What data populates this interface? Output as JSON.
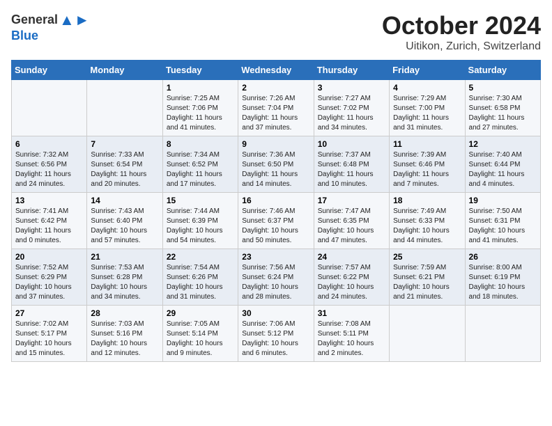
{
  "header": {
    "logo": {
      "line1": "General",
      "line2": "Blue"
    },
    "month": "October 2024",
    "location": "Uitikon, Zurich, Switzerland"
  },
  "weekdays": [
    "Sunday",
    "Monday",
    "Tuesday",
    "Wednesday",
    "Thursday",
    "Friday",
    "Saturday"
  ],
  "weeks": [
    [
      {
        "day": "",
        "info": ""
      },
      {
        "day": "",
        "info": ""
      },
      {
        "day": "1",
        "info": "Sunrise: 7:25 AM\nSunset: 7:06 PM\nDaylight: 11 hours and 41 minutes."
      },
      {
        "day": "2",
        "info": "Sunrise: 7:26 AM\nSunset: 7:04 PM\nDaylight: 11 hours and 37 minutes."
      },
      {
        "day": "3",
        "info": "Sunrise: 7:27 AM\nSunset: 7:02 PM\nDaylight: 11 hours and 34 minutes."
      },
      {
        "day": "4",
        "info": "Sunrise: 7:29 AM\nSunset: 7:00 PM\nDaylight: 11 hours and 31 minutes."
      },
      {
        "day": "5",
        "info": "Sunrise: 7:30 AM\nSunset: 6:58 PM\nDaylight: 11 hours and 27 minutes."
      }
    ],
    [
      {
        "day": "6",
        "info": "Sunrise: 7:32 AM\nSunset: 6:56 PM\nDaylight: 11 hours and 24 minutes."
      },
      {
        "day": "7",
        "info": "Sunrise: 7:33 AM\nSunset: 6:54 PM\nDaylight: 11 hours and 20 minutes."
      },
      {
        "day": "8",
        "info": "Sunrise: 7:34 AM\nSunset: 6:52 PM\nDaylight: 11 hours and 17 minutes."
      },
      {
        "day": "9",
        "info": "Sunrise: 7:36 AM\nSunset: 6:50 PM\nDaylight: 11 hours and 14 minutes."
      },
      {
        "day": "10",
        "info": "Sunrise: 7:37 AM\nSunset: 6:48 PM\nDaylight: 11 hours and 10 minutes."
      },
      {
        "day": "11",
        "info": "Sunrise: 7:39 AM\nSunset: 6:46 PM\nDaylight: 11 hours and 7 minutes."
      },
      {
        "day": "12",
        "info": "Sunrise: 7:40 AM\nSunset: 6:44 PM\nDaylight: 11 hours and 4 minutes."
      }
    ],
    [
      {
        "day": "13",
        "info": "Sunrise: 7:41 AM\nSunset: 6:42 PM\nDaylight: 11 hours and 0 minutes."
      },
      {
        "day": "14",
        "info": "Sunrise: 7:43 AM\nSunset: 6:40 PM\nDaylight: 10 hours and 57 minutes."
      },
      {
        "day": "15",
        "info": "Sunrise: 7:44 AM\nSunset: 6:39 PM\nDaylight: 10 hours and 54 minutes."
      },
      {
        "day": "16",
        "info": "Sunrise: 7:46 AM\nSunset: 6:37 PM\nDaylight: 10 hours and 50 minutes."
      },
      {
        "day": "17",
        "info": "Sunrise: 7:47 AM\nSunset: 6:35 PM\nDaylight: 10 hours and 47 minutes."
      },
      {
        "day": "18",
        "info": "Sunrise: 7:49 AM\nSunset: 6:33 PM\nDaylight: 10 hours and 44 minutes."
      },
      {
        "day": "19",
        "info": "Sunrise: 7:50 AM\nSunset: 6:31 PM\nDaylight: 10 hours and 41 minutes."
      }
    ],
    [
      {
        "day": "20",
        "info": "Sunrise: 7:52 AM\nSunset: 6:29 PM\nDaylight: 10 hours and 37 minutes."
      },
      {
        "day": "21",
        "info": "Sunrise: 7:53 AM\nSunset: 6:28 PM\nDaylight: 10 hours and 34 minutes."
      },
      {
        "day": "22",
        "info": "Sunrise: 7:54 AM\nSunset: 6:26 PM\nDaylight: 10 hours and 31 minutes."
      },
      {
        "day": "23",
        "info": "Sunrise: 7:56 AM\nSunset: 6:24 PM\nDaylight: 10 hours and 28 minutes."
      },
      {
        "day": "24",
        "info": "Sunrise: 7:57 AM\nSunset: 6:22 PM\nDaylight: 10 hours and 24 minutes."
      },
      {
        "day": "25",
        "info": "Sunrise: 7:59 AM\nSunset: 6:21 PM\nDaylight: 10 hours and 21 minutes."
      },
      {
        "day": "26",
        "info": "Sunrise: 8:00 AM\nSunset: 6:19 PM\nDaylight: 10 hours and 18 minutes."
      }
    ],
    [
      {
        "day": "27",
        "info": "Sunrise: 7:02 AM\nSunset: 5:17 PM\nDaylight: 10 hours and 15 minutes."
      },
      {
        "day": "28",
        "info": "Sunrise: 7:03 AM\nSunset: 5:16 PM\nDaylight: 10 hours and 12 minutes."
      },
      {
        "day": "29",
        "info": "Sunrise: 7:05 AM\nSunset: 5:14 PM\nDaylight: 10 hours and 9 minutes."
      },
      {
        "day": "30",
        "info": "Sunrise: 7:06 AM\nSunset: 5:12 PM\nDaylight: 10 hours and 6 minutes."
      },
      {
        "day": "31",
        "info": "Sunrise: 7:08 AM\nSunset: 5:11 PM\nDaylight: 10 hours and 2 minutes."
      },
      {
        "day": "",
        "info": ""
      },
      {
        "day": "",
        "info": ""
      }
    ]
  ]
}
